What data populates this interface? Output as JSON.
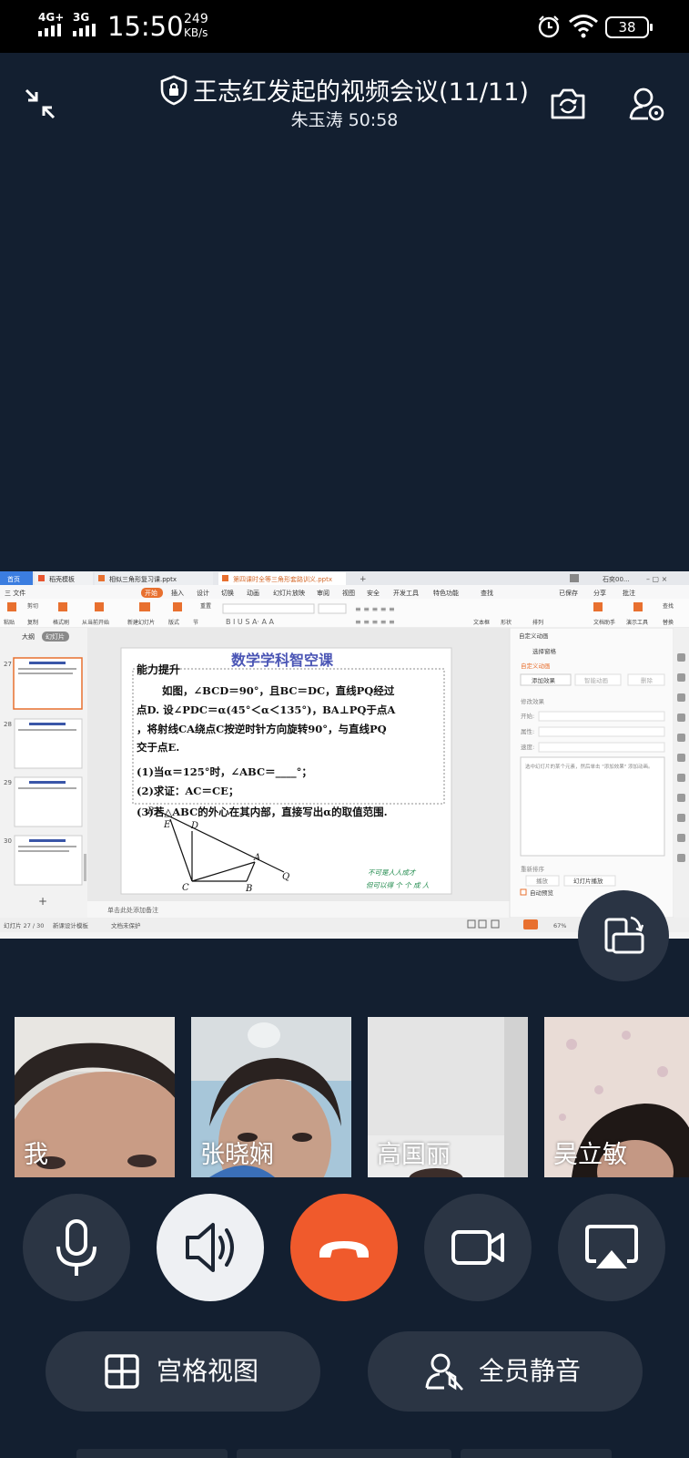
{
  "status_bar": {
    "network_primary": "4G+",
    "network_secondary": "3G",
    "time": "15:50",
    "speed_value": "249",
    "speed_unit": "KB/s",
    "battery": "38"
  },
  "header": {
    "title": "王志红发起的视频会议(11/11)",
    "subtitle": "朱玉涛 50:58"
  },
  "shared_screen": {
    "tabs": [
      "首页",
      "稻壳模板",
      "相似三角形复习课.pptx",
      "第四课时全等三角形套路训义.pptx"
    ],
    "menu": [
      "三 文件",
      "开始",
      "插入",
      "设计",
      "切换",
      "动画",
      "幻灯片放映",
      "审阅",
      "视图",
      "安全",
      "开发工具",
      "特色功能",
      "查找"
    ],
    "menu_right": [
      "已保存",
      "分享",
      "批注"
    ],
    "toolbar": [
      "粘贴",
      "剪切",
      "复制",
      "格式刷",
      "从当前开始",
      "新建幻灯片",
      "版式",
      "节",
      "重置",
      "文本框",
      "形状",
      "排列",
      "文档助手",
      "演示工具",
      "查找",
      "替换"
    ],
    "panel_tabs": [
      "大纲",
      "幻灯片"
    ],
    "slide_numbers": [
      "27",
      "28",
      "29",
      "30"
    ],
    "slide": {
      "header": "数学学科智空课",
      "section": "能力提升",
      "line1": "如图，∠BCD＝90°，且BC＝DC，直线PQ经过",
      "line2": "点D. 设∠PDC＝α(45°＜α＜135°)，BA⊥PQ于点A",
      "line3": "，将射线CA绕点C按逆时针方向旋转90°，与直线PQ",
      "line4": "交于点E.",
      "q1": "(1)当α＝125°时，∠ABC＝____°；",
      "q2": "(2)求证：AC＝CE；",
      "q3": "(3)若△ABC的外心在其内部，直接写出α的取值范围.",
      "points": [
        "P",
        "E",
        "D",
        "A",
        "Q",
        "C",
        "B"
      ],
      "signature1": "不可是人人成才",
      "signature2": "但可以得 个 个 成 人"
    },
    "notes_hint": "单击此处添加备注",
    "status_left": "幻灯片 27 / 30",
    "status_theme": "新课设计模板",
    "status_protect": "文档未保护",
    "zoom": "67%",
    "right_panel": {
      "title": "自定义动画",
      "select_pane": "选择窗格",
      "custom_anim": "自定义动画",
      "add_effect": "添加效果",
      "smart_anim": "智能动画",
      "delete": "删除",
      "modify": "修改效果",
      "start": "开始:",
      "property": "属性:",
      "speed": "速度:",
      "hint": "选中幻灯片的某个元素，然后单击 \"添加效果\" 添加动画。",
      "reorder": "重新排序",
      "play": "播放",
      "slideshow": "幻灯片播放",
      "autopreview": "自动预览"
    }
  },
  "participants": [
    {
      "name": "我"
    },
    {
      "name": "张晓娴"
    },
    {
      "name": "高国丽"
    },
    {
      "name": "吴立敏"
    }
  ],
  "controls": {
    "grid_view": "宫格视图",
    "mute_all": "全员静音"
  },
  "colors": {
    "background": "#131f30",
    "button": "#2b3544",
    "hangup": "#f05a2c",
    "active": "#eef0f3"
  }
}
